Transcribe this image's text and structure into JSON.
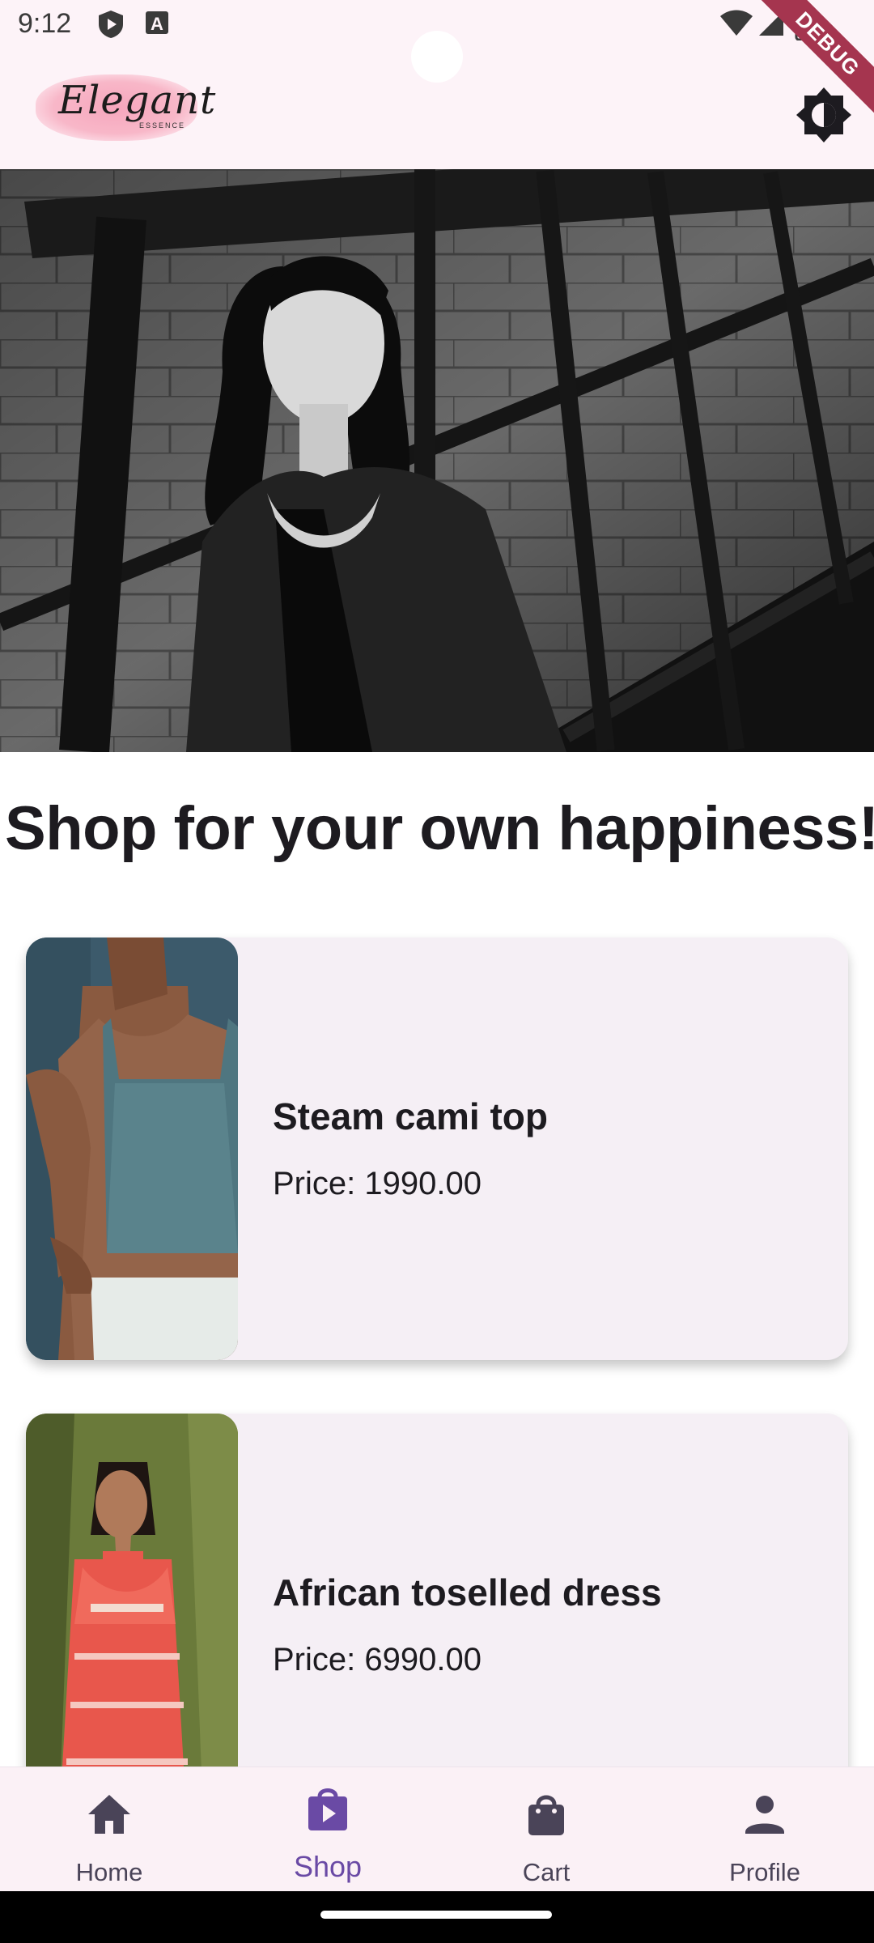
{
  "status_bar": {
    "time": "9:12",
    "icons": [
      "play-protect-icon",
      "a-icon",
      "wifi-icon",
      "signal-icon",
      "battery-icon"
    ]
  },
  "app_bar": {
    "logo_text": "Elegant",
    "logo_subtext": "ESSENCE",
    "theme_toggle_icon": "brightness-icon"
  },
  "debug_banner": "DEBUG",
  "headline": "Shop for your own happiness!",
  "products": [
    {
      "name": "Steam cami top",
      "price": "Price: 1990.00"
    },
    {
      "name": "African toselled dress",
      "price": "Price: 6990.00"
    }
  ],
  "bottom_nav": {
    "items": [
      {
        "label": "Home",
        "icon": "home-icon"
      },
      {
        "label": "Shop",
        "icon": "shopping-bag-play-icon"
      },
      {
        "label": "Cart",
        "icon": "bag-icon"
      },
      {
        "label": "Profile",
        "icon": "person-icon"
      }
    ],
    "active": "Shop"
  },
  "colors": {
    "app_bar_bg": "#fdf3f8",
    "card_bg": "#f5eff5",
    "nav_active": "#6a4aa5",
    "nav_inactive": "#4a4458"
  }
}
